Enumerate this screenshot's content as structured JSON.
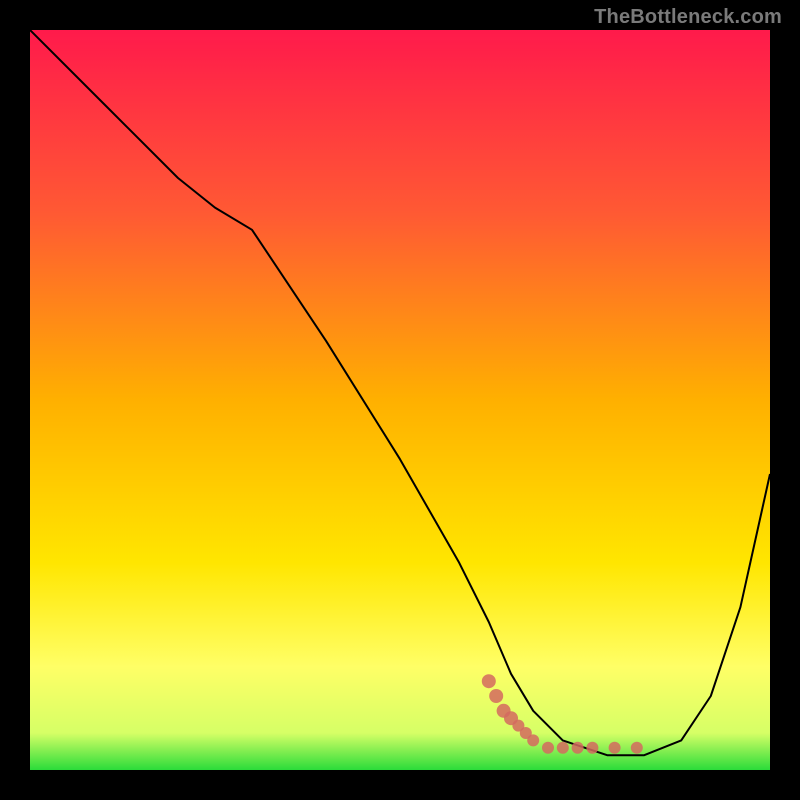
{
  "watermark": "TheBottleneck.com",
  "chart_data": {
    "type": "line",
    "title": "",
    "xlabel": "",
    "ylabel": "",
    "xlim": [
      0,
      100
    ],
    "ylim": [
      0,
      100
    ],
    "grid": false,
    "legend": false,
    "gradient_stops": [
      {
        "offset": 0,
        "color": "#ff1a4b"
      },
      {
        "offset": 25,
        "color": "#ff5a33"
      },
      {
        "offset": 50,
        "color": "#ffb000"
      },
      {
        "offset": 72,
        "color": "#ffe600"
      },
      {
        "offset": 86,
        "color": "#ffff66"
      },
      {
        "offset": 95,
        "color": "#d6ff66"
      },
      {
        "offset": 100,
        "color": "#2bdc3a"
      }
    ],
    "series": [
      {
        "name": "bottleneck-curve",
        "type": "line",
        "color": "#000000",
        "x": [
          0,
          10,
          20,
          25,
          30,
          40,
          50,
          58,
          62,
          65,
          68,
          72,
          78,
          83,
          88,
          92,
          96,
          100
        ],
        "y": [
          100,
          90,
          80,
          76,
          73,
          58,
          42,
          28,
          20,
          13,
          8,
          4,
          2,
          2,
          4,
          10,
          22,
          40
        ]
      },
      {
        "name": "highlight-dots",
        "type": "scatter",
        "color": "#d46a5f",
        "x": [
          62,
          63,
          64,
          65,
          66,
          67,
          68,
          70,
          72,
          74,
          76,
          79,
          82
        ],
        "y": [
          12,
          10,
          8,
          7,
          6,
          5,
          4,
          3,
          3,
          3,
          3,
          3,
          3
        ]
      }
    ]
  }
}
